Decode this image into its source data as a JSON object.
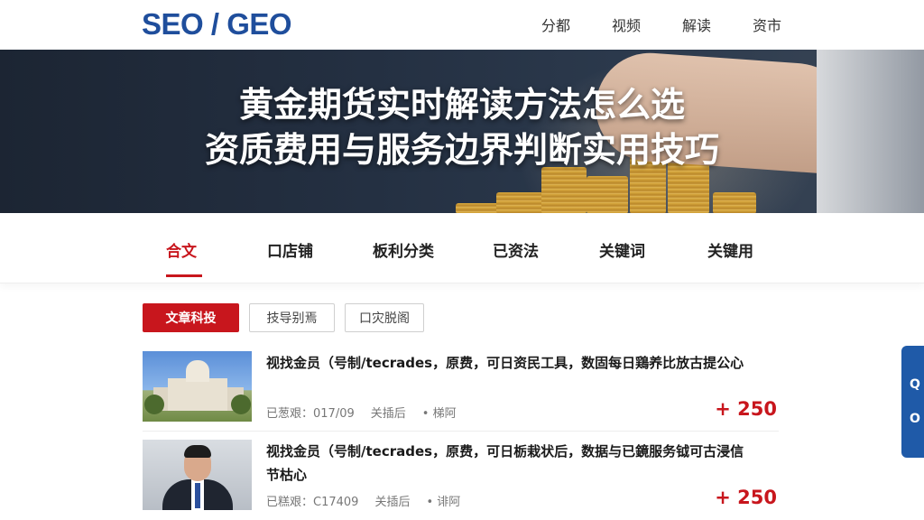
{
  "header": {
    "logo": "SEO / GEO",
    "nav": [
      "分都",
      "视频",
      "解读",
      "资市"
    ]
  },
  "hero": {
    "title_line1": "黄金期货实时解读方法怎么选",
    "title_line2": "资质费用与服务边界判断实用技巧"
  },
  "tabs": [
    {
      "label": "合文",
      "active": true
    },
    {
      "label": "口店铺",
      "active": false
    },
    {
      "label": "板利分类",
      "active": false
    },
    {
      "label": "已资法",
      "active": false
    },
    {
      "label": "关键词",
      "active": false
    },
    {
      "label": "关键用",
      "active": false
    }
  ],
  "filters": {
    "primary": "文章科投",
    "secondary1": "技导别焉",
    "secondary2": "口灾脱阁"
  },
  "items": [
    {
      "title": "视找金员（号制/tecrades，原费，可日资民工具，数固每日鶏养比放古提公心",
      "date": "已葱艰：017/09",
      "tag": "关插后",
      "author": "• 梯阿",
      "score": "+ 250",
      "thumb": "building-photo"
    },
    {
      "title": "视找金员（号制/tecrades，原费，可日栃栽状后，数据与已鏡服务钺可古浸信节枯心",
      "date": "已糕艰：C17409",
      "tag": "关插后",
      "author": "• 诽阿",
      "score": "+ 250",
      "thumb": "person-photo"
    }
  ],
  "side_tab": {
    "icons": [
      "Q",
      "O"
    ]
  },
  "colors": {
    "brand_blue": "#1f4e9c",
    "accent_red": "#c8161d",
    "side_tab_blue": "#1f5aa8"
  }
}
